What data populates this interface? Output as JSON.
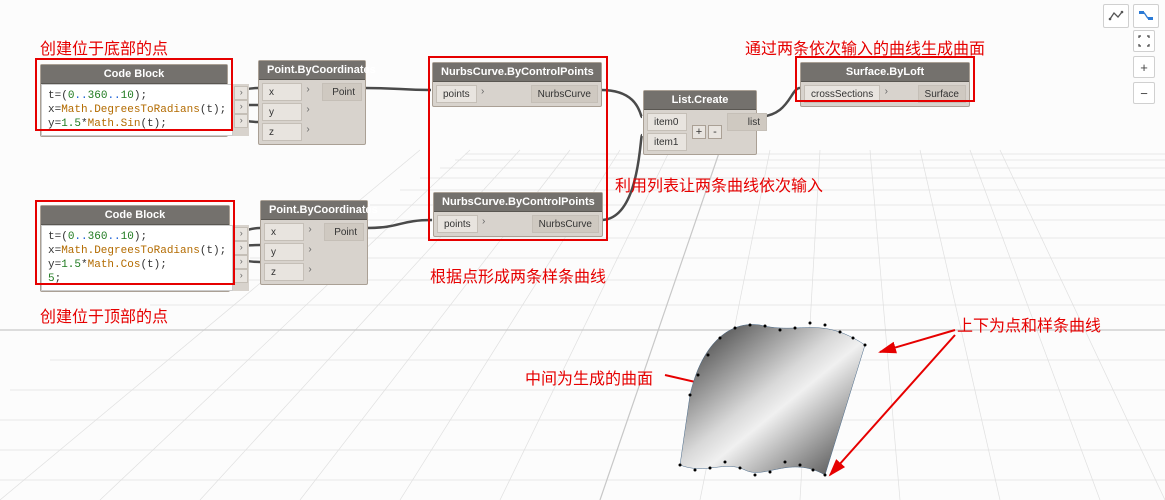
{
  "annotations": {
    "top_left": "创建位于底部的点",
    "top_right": "通过两条依次输入的曲线生成曲面",
    "list_note": "利用列表让两条曲线依次输入",
    "curves_note": "根据点形成两条样条曲线",
    "bottom_left": "创建位于顶部的点",
    "mid_surface": "中间为生成的曲面",
    "curves_label": "上下为点和样条曲线"
  },
  "nodes": {
    "codeblock1": {
      "title": "Code Block",
      "code": "t=(0..360..10);\nx=Math.DegreesToRadians(t);\ny=1.5*Math.Sin(t);"
    },
    "codeblock2": {
      "title": "Code Block",
      "code": "t=(0..360..10);\nx=Math.DegreesToRadians(t);\ny=1.5*Math.Cos(t);\n5;"
    },
    "point1": {
      "title": "Point.ByCoordinates",
      "in": [
        "x",
        "y",
        "z"
      ],
      "out": "Point"
    },
    "point2": {
      "title": "Point.ByCoordinates",
      "in": [
        "x",
        "y",
        "z"
      ],
      "out": "Point"
    },
    "nurbs1": {
      "title": "NurbsCurve.ByControlPoints",
      "in": "points",
      "out": "NurbsCurve"
    },
    "nurbs2": {
      "title": "NurbsCurve.ByControlPoints",
      "in": "points",
      "out": "NurbsCurve"
    },
    "listcreate": {
      "title": "List.Create",
      "in": [
        "item0",
        "item1"
      ],
      "plus": "+",
      "minus": "-",
      "out": "list"
    },
    "loft": {
      "title": "Surface.ByLoft",
      "in": "crossSections",
      "out": "Surface"
    }
  },
  "toolbar": {
    "wire_icon": "wireframe",
    "node_icon": "node-view"
  }
}
